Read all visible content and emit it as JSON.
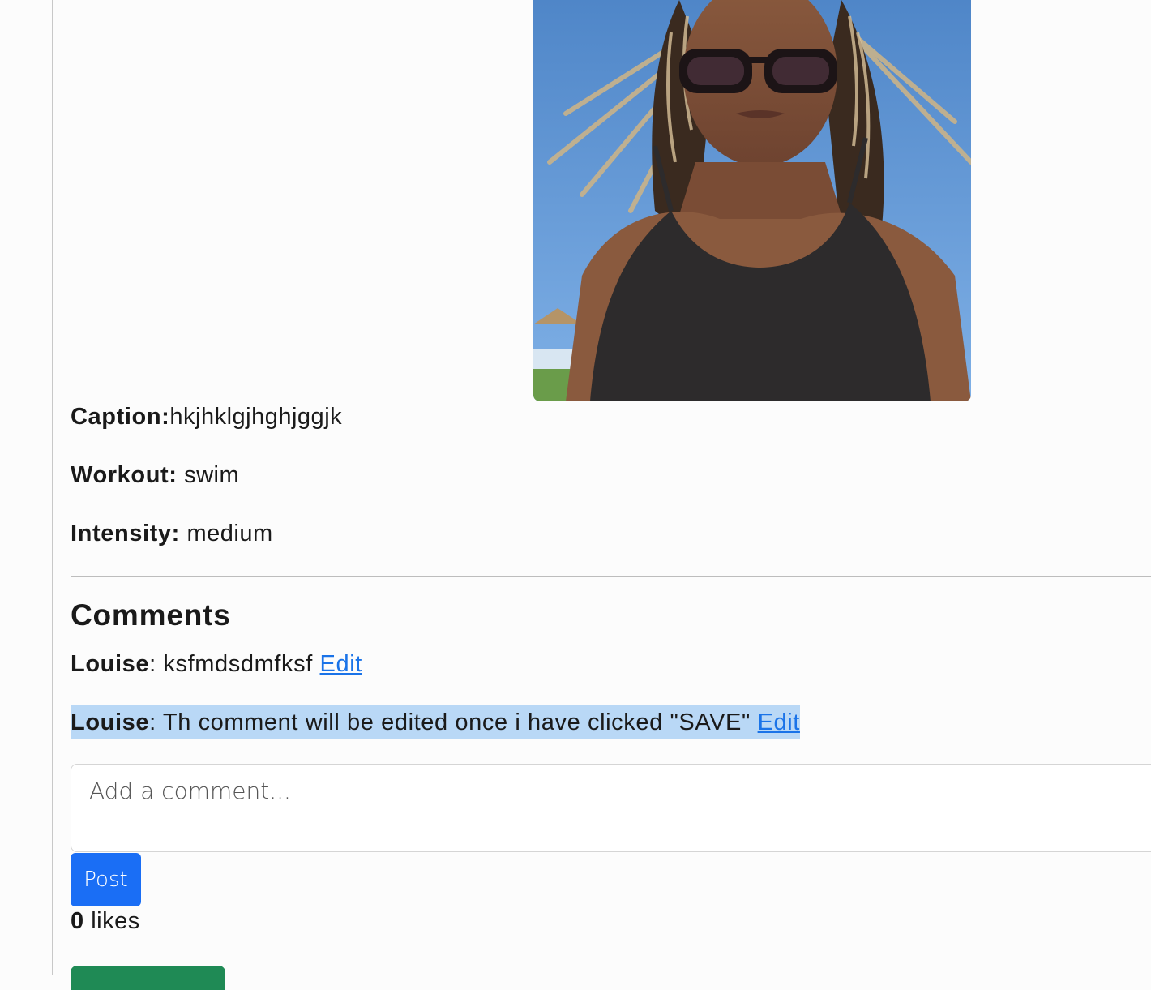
{
  "post": {
    "photo_alt": "post photo",
    "caption_label": "Caption:",
    "caption_value": "hkjhklgjhghjggjk",
    "workout_label": "Workout:",
    "workout_value": "swim",
    "intensity_label": "Intensity:",
    "intensity_value": "medium"
  },
  "comments": {
    "heading": "Comments",
    "items": [
      {
        "author": "Louise",
        "separator": ":",
        "text": "ksfmdsdmfksf",
        "edit_label": "Edit"
      },
      {
        "author": "Louise",
        "separator": ":",
        "text": "Th comment will be edited once i have clicked \"SAVE\"",
        "edit_label": "Edit"
      }
    ],
    "input_placeholder": "Add a comment...",
    "post_label": "Post"
  },
  "likes": {
    "count": "0",
    "label": "likes"
  },
  "colors": {
    "accent": "#1a6ef5",
    "link": "#1a73e8",
    "selection": "#b9d8f6",
    "green_button": "#1f8a55"
  }
}
